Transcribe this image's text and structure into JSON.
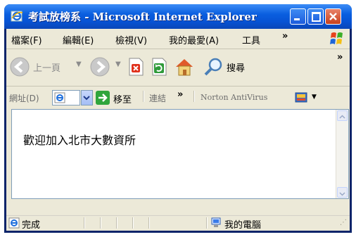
{
  "window": {
    "title": "考試放榜系 - Microsoft Internet Explorer"
  },
  "menubar": {
    "items": [
      "檔案(F)",
      "編輯(E)",
      "檢視(V)",
      "我的最愛(A)",
      "工具"
    ],
    "overflow": "»"
  },
  "toolbar": {
    "back_label": "上一頁",
    "search_label": "搜尋",
    "overflow": "»"
  },
  "addressbar": {
    "label": "網址(D)",
    "go_label": "移至",
    "links_label": "連結",
    "links_overflow": "»",
    "norton_label": "Norton AntiVirus"
  },
  "content": {
    "text": "歡迎加入北市大數資所"
  },
  "statusbar": {
    "status": "完成",
    "zone": "我的電腦"
  },
  "colors": {
    "titlebar": "#0753d4",
    "chrome": "#ece9d8",
    "close_button": "#c8401c",
    "go_arrow": "#2fa53c"
  }
}
